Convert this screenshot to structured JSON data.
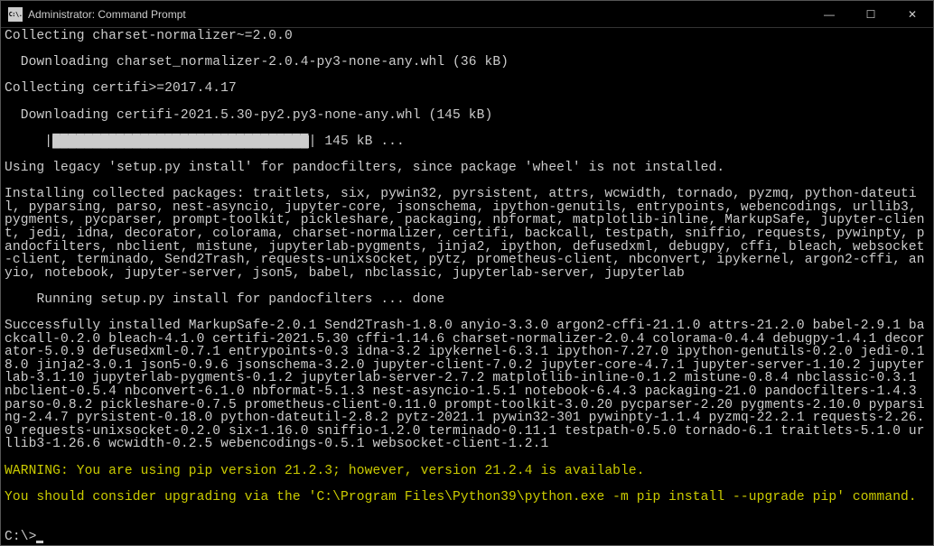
{
  "titlebar": {
    "icon_text": "C:\\.",
    "title": "Administrator: Command Prompt",
    "minimize": "—",
    "maximize": "☐",
    "close": "✕"
  },
  "terminal": {
    "lines": [
      {
        "text": "Collecting charset-normalizer~=2.0.0"
      },
      {
        "text": "  Downloading charset_normalizer-2.0.4-py3-none-any.whl (36 kB)"
      },
      {
        "text": "Collecting certifi>=2017.4.17"
      },
      {
        "text": "  Downloading certifi-2021.5.30-py2.py3-none-any.whl (145 kB)"
      },
      {
        "text": "     |████████████████████████████████| 145 kB ...",
        "progress": true
      },
      {
        "text": "Using legacy 'setup.py install' for pandocfilters, since package 'wheel' is not installed."
      },
      {
        "text": "Installing collected packages: traitlets, six, pywin32, pyrsistent, attrs, wcwidth, tornado, pyzmq, python-dateutil, pyparsing, parso, nest-asyncio, jupyter-core, jsonschema, ipython-genutils, entrypoints, webencodings, urllib3, pygments, pycparser, prompt-toolkit, pickleshare, packaging, nbformat, matplotlib-inline, MarkupSafe, jupyter-client, jedi, idna, decorator, colorama, charset-normalizer, certifi, backcall, testpath, sniffio, requests, pywinpty, pandocfilters, nbclient, mistune, jupyterlab-pygments, jinja2, ipython, defusedxml, debugpy, cffi, bleach, websocket-client, terminado, Send2Trash, requests-unixsocket, pytz, prometheus-client, nbconvert, ipykernel, argon2-cffi, anyio, notebook, jupyter-server, json5, babel, nbclassic, jupyterlab-server, jupyterlab"
      },
      {
        "text": "    Running setup.py install for pandocfilters ... done"
      },
      {
        "text": "Successfully installed MarkupSafe-2.0.1 Send2Trash-1.8.0 anyio-3.3.0 argon2-cffi-21.1.0 attrs-21.2.0 babel-2.9.1 backcall-0.2.0 bleach-4.1.0 certifi-2021.5.30 cffi-1.14.6 charset-normalizer-2.0.4 colorama-0.4.4 debugpy-1.4.1 decorator-5.0.9 defusedxml-0.7.1 entrypoints-0.3 idna-3.2 ipykernel-6.3.1 ipython-7.27.0 ipython-genutils-0.2.0 jedi-0.18.0 jinja2-3.0.1 json5-0.9.6 jsonschema-3.2.0 jupyter-client-7.0.2 jupyter-core-4.7.1 jupyter-server-1.10.2 jupyterlab-3.1.10 jupyterlab-pygments-0.1.2 jupyterlab-server-2.7.2 matplotlib-inline-0.1.2 mistune-0.8.4 nbclassic-0.3.1 nbclient-0.5.4 nbconvert-6.1.0 nbformat-5.1.3 nest-asyncio-1.5.1 notebook-6.4.3 packaging-21.0 pandocfilters-1.4.3 parso-0.8.2 pickleshare-0.7.5 prometheus-client-0.11.0 prompt-toolkit-3.0.20 pycparser-2.20 pygments-2.10.0 pyparsing-2.4.7 pyrsistent-0.18.0 python-dateutil-2.8.2 pytz-2021.1 pywin32-301 pywinpty-1.1.4 pyzmq-22.2.1 requests-2.26.0 requests-unixsocket-0.2.0 six-1.16.0 sniffio-1.2.0 terminado-0.11.1 testpath-0.5.0 tornado-6.1 traitlets-5.1.0 urllib3-1.26.6 wcwidth-0.2.5 webencodings-0.5.1 websocket-client-1.2.1"
      },
      {
        "text": "WARNING: You are using pip version 21.2.3; however, version 21.2.4 is available.",
        "class": "warning"
      },
      {
        "text": "You should consider upgrading via the 'C:\\Program Files\\Python39\\python.exe -m pip install --upgrade pip' command.",
        "class": "warning"
      },
      {
        "text": ""
      },
      {
        "text": "C:\\>",
        "prompt": true
      }
    ]
  }
}
